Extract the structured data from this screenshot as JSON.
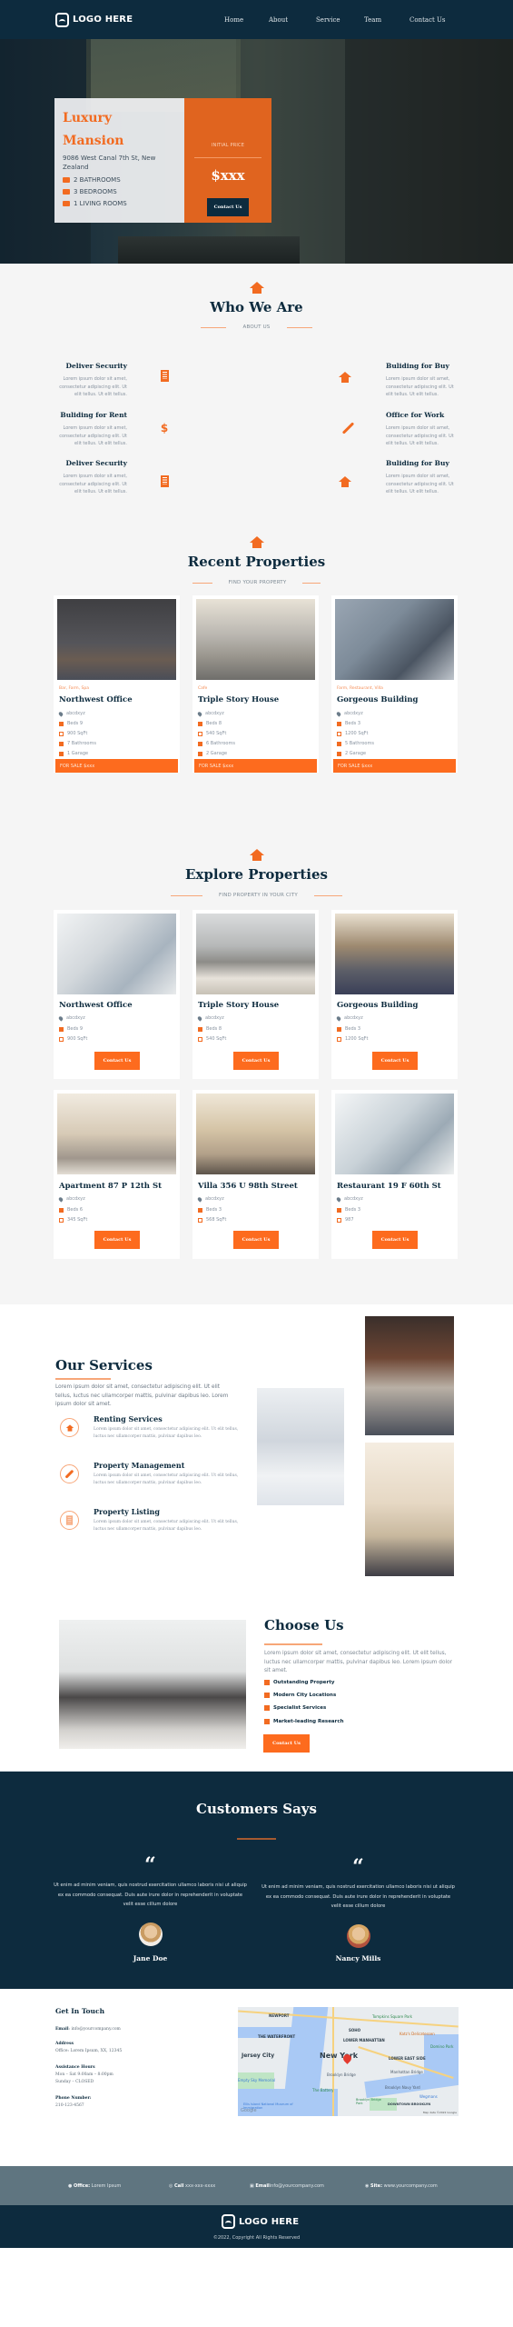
{
  "header": {
    "logo_text": "LOGO HERE",
    "nav": [
      "Home",
      "About",
      "Service",
      "Team",
      "Contact Us"
    ]
  },
  "hero": {
    "title_line1": "Luxury",
    "title_line2": "Mansion",
    "address": "9086 West Canal 7th St, New Zealand",
    "features": [
      {
        "icon": "bathtub-icon",
        "label": "2 BATHROOMS"
      },
      {
        "icon": "bed-icon",
        "label": "3 BEDROOMS"
      },
      {
        "icon": "sofa-icon",
        "label": "1 LIVING ROOMS"
      }
    ],
    "price_label": "INITIAL PRICE",
    "price": "$xxx",
    "cta": "Contact Us"
  },
  "who": {
    "title": "Who We Are",
    "subtitle": "ABOUT US",
    "items": [
      {
        "title": "Deliver Security",
        "text": "Lorem ipsum dolor sit amet, consectetur adipiscing elit. Ut elit tellus. Ut elit tellus.",
        "icon": "building-icon"
      },
      {
        "title": "Buliding for Rent",
        "text": "Lorem ipsum dolor sit amet, consectetur adipiscing elit. Ut elit tellus. Ut elit tellus.",
        "icon": "dollar-icon"
      },
      {
        "title": "Deliver Security",
        "text": "Lorem ipsum dolor sit amet, consectetur adipiscing elit. Ut elit tellus. Ut elit tellus.",
        "icon": "building-icon"
      },
      {
        "title": "Buliding for Buy",
        "text": "Lorem ipsum dolor sit amet, consectetur adipiscing elit. Ut elit tellus. Ut elit tellus.",
        "icon": "house-icon"
      },
      {
        "title": "Office for Work",
        "text": "Lorem ipsum dolor sit amet, consectetur adipiscing elit. Ut elit tellus. Ut elit tellus.",
        "icon": "wrench-icon"
      },
      {
        "title": "Buliding for Buy",
        "text": "Lorem ipsum dolor sit amet, consectetur adipiscing elit. Ut elit tellus. Ut elit tellus.",
        "icon": "house-icon"
      }
    ]
  },
  "recent": {
    "title": "Recent Properties",
    "subtitle": "FIND YOUR PROPERTY",
    "cards": [
      {
        "tags": "Bar, Farm, Spa",
        "name": "Northwest Office",
        "location": "abcdxyz",
        "beds": "Beds 9",
        "area": "900 SqFt",
        "baths": "7 Bathrooms",
        "garage": "1 Garage",
        "sale": "FOR SALE $xxx"
      },
      {
        "tags": "Cafe",
        "name": "Triple Story House",
        "location": "abcdxyz",
        "beds": "Beds 8",
        "area": "540 SqFt",
        "baths": "6 Bathrooms",
        "garage": "2 Garage",
        "sale": "FOR SALE $xxx"
      },
      {
        "tags": "Farm, Restaurant, Villa",
        "name": "Gorgeous Building",
        "location": "abcdxyz",
        "beds": "Beds 3",
        "area": "1200 SqFt",
        "baths": "5 Bathrooms",
        "garage": "2 Garage",
        "sale": "FOR SALE $xxx"
      }
    ]
  },
  "explore": {
    "title": "Explore Properties",
    "subtitle": "FIND PROPERTY IN YOUR CITY",
    "cta": "Contact Us",
    "cards": [
      {
        "name": "Northwest Office",
        "location": "abcdxyz",
        "beds": "Beds 9",
        "area": "900 SqFt"
      },
      {
        "name": "Triple Story House",
        "location": "abcdxyz",
        "beds": "Beds 8",
        "area": "540 SqFt"
      },
      {
        "name": "Gorgeous Building",
        "location": "abcdxyz",
        "beds": "Beds 3",
        "area": "1200 SqFt"
      },
      {
        "name": "Apartment 87 P 12th St",
        "location": "abcdxyz",
        "beds": "Beds 6",
        "area": "345 SqFt"
      },
      {
        "name": "Villa 356 U 98th Street",
        "location": "abcdxyz",
        "beds": "Beds 3",
        "area": "568 SqFt"
      },
      {
        "name": "Restaurant 19 F 60th St",
        "location": "abcdxyz",
        "beds": "Beds 3",
        "area": "987"
      }
    ]
  },
  "services": {
    "title": "Our Services",
    "intro": "Lorem ipsum dolor sit amet, consectetur adipiscing elit. Ut elit tellus, luctus nec ullamcorper mattis, pulvinar dapibus leo. Lorem ipsum dolor sit amet.",
    "items": [
      {
        "title": "Renting Services",
        "text": "Lorem ipsum dolor sit amet, consectetur adipiscing elit. Ut elit tellus, luctus nec ullamcorper mattis, pulvinar dapibus leo.",
        "icon": "house-icon"
      },
      {
        "title": "Property Management",
        "text": "Lorem ipsum dolor sit amet, consectetur adipiscing elit. Ut elit tellus, luctus nec ullamcorper mattis, pulvinar dapibus leo.",
        "icon": "wrench-icon"
      },
      {
        "title": "Property Listing",
        "text": "Lorem ipsum dolor sit amet, consectetur adipiscing elit. Ut elit tellus, luctus nec ullamcorper mattis, pulvinar dapibus leo.",
        "icon": "building-icon"
      }
    ]
  },
  "choose": {
    "title": "Choose Us",
    "intro": "Lorem ipsum dolor sit amet, consectetur adipiscing elit. Ut elit tellus, luctus nec ullamcorper mattis, pulvinar dapibus leo. Lorem ipsum dolor sit amet.",
    "list": [
      "Outstanding Property",
      "Modern City Locations",
      "Specialist Services",
      "Market-leading Research"
    ],
    "cta": "Contact Us"
  },
  "testimonials": {
    "title": "Customers Says",
    "items": [
      {
        "quote": "Ut enim ad minim veniam, quis nostrud exercitation ullamco laboris nisi ut aliquip ex ea commodo consequat. Duis aute irure dolor in reprehenderit in voluptate velit esse cillum dolore",
        "name": "Jane Doe"
      },
      {
        "quote": "Ut enim ad minim veniam, quis nostrud exercitation ullamco laboris nisi ut aliquip ex ea commodo consequat. Duis aute irure dolor in reprehenderit in voluptate velit esse cillum dolore",
        "name": "Nancy Mills"
      }
    ]
  },
  "contact": {
    "title": "Get In Touch",
    "email_label": "Email",
    "email": ": info@yourcompany.com",
    "address_label": "Address",
    "address": "Office: Lorem Ipsum, XX, 12345",
    "hours_label": "Assistance Hours",
    "hours_1": "Mon – Sat 9:00am – 8:00pm",
    "hours_2": "Sunday – CLOSED",
    "phone_label": "Phone Number:",
    "phone": "210-123-4567",
    "map": {
      "labels": [
        "NEWPORT",
        "THE WATERFRONT",
        "Jersey City",
        "New York",
        "SOHO",
        "LOWER MANHATTAN",
        "LOWER EAST SIDE",
        "Tompkins Square Park",
        "Katz's Delicatessen",
        "Brooklyn Bridge",
        "Manhattan Bridge",
        "Brooklyn Navy Yard",
        "The Battery",
        "Empty Sky Memorial",
        "Ellis Island National Museum of Immigration",
        "Brooklyn Bridge Park",
        "DOWNTOWN BROOKLYN",
        "Wegmans",
        "Domino Park"
      ],
      "attribution": "Map data ©2022 Google",
      "google": "Google"
    }
  },
  "footer_bar": {
    "office_label": "Office:",
    "office": "Lorem Ipsum",
    "call_label": "Call",
    "call": "xxx-xxx-xxxx",
    "email_label": "Email",
    "email": "info@yourcompany.com",
    "site_label": "Site:",
    "site": "www.yourcompany.com"
  },
  "footer": {
    "logo_text": "LOGO HERE",
    "copyright": "©2022, Copyright All Rights Reserved"
  }
}
